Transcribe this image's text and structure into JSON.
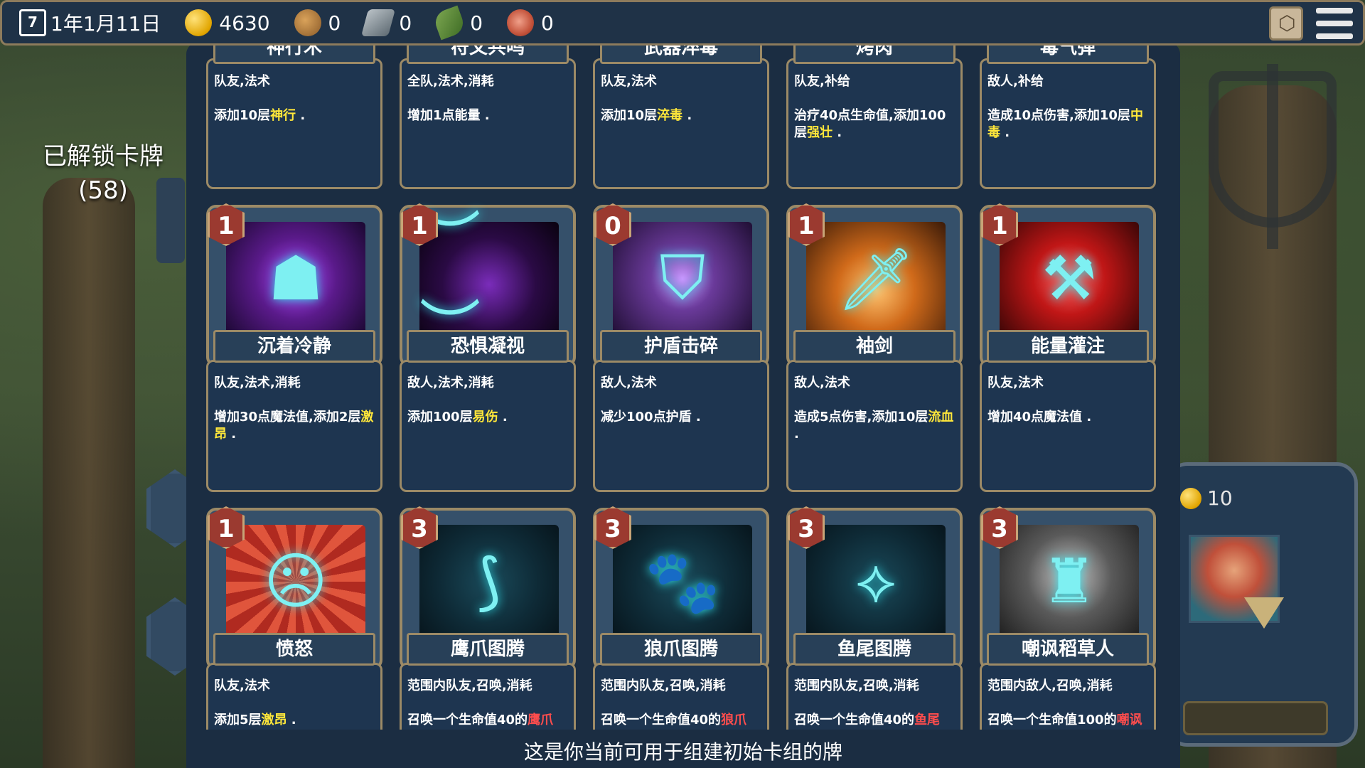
{
  "topbar": {
    "date": "1年1月11日",
    "calendar_day": "7",
    "gold": "4630",
    "wood": "0",
    "iron": "0",
    "herb": "0",
    "meat": "0"
  },
  "left": {
    "unlocked_title": "已解锁卡牌",
    "unlocked_count": "(58)"
  },
  "right": {
    "coin_value": "10"
  },
  "cards": [
    {
      "name": "神行术",
      "cost": "",
      "tags": "队友,法术",
      "desc": [
        {
          "t": "添加10层"
        },
        {
          "t": "神行",
          "c": "hl"
        },
        {
          "t": " ."
        }
      ],
      "art": "art-purple"
    },
    {
      "name": "符文共鸣",
      "cost": "",
      "tags": "全队,法术,消耗",
      "desc": [
        {
          "t": "增加1点能量 ."
        }
      ],
      "art": "art-purple"
    },
    {
      "name": "武器淬毒",
      "cost": "",
      "tags": "队友,法术",
      "desc": [
        {
          "t": "添加10层"
        },
        {
          "t": "淬毒",
          "c": "hl"
        },
        {
          "t": " ."
        }
      ],
      "art": "art-purple"
    },
    {
      "name": "烤肉",
      "cost": "",
      "tags": "队友,补给",
      "desc": [
        {
          "t": "治疗40点生命值,添加100层"
        },
        {
          "t": "强壮",
          "c": "hl"
        },
        {
          "t": " ."
        }
      ],
      "art": "art-purple"
    },
    {
      "name": "毒气弹",
      "cost": "",
      "tags": "敌人,补给",
      "desc": [
        {
          "t": "造成10点伤害,添加10层"
        },
        {
          "t": "中毒",
          "c": "hl"
        },
        {
          "t": " ."
        }
      ],
      "art": "art-purple"
    },
    {
      "name": "沉着冷静",
      "cost": "1",
      "tags": "队友,法术,消耗",
      "desc": [
        {
          "t": "增加30点魔法值,添加2层"
        },
        {
          "t": "激昂",
          "c": "hl"
        },
        {
          "t": " ."
        }
      ],
      "art": "art-purple",
      "glyph": "☗"
    },
    {
      "name": "恐惧凝视",
      "cost": "1",
      "tags": "敌人,法术,消耗",
      "desc": [
        {
          "t": "添加100层"
        },
        {
          "t": "易伤",
          "c": "hl"
        },
        {
          "t": " ."
        }
      ],
      "art": "art-dark",
      "glyph": "︶ ︶"
    },
    {
      "name": "护盾击碎",
      "cost": "0",
      "tags": "敌人,法术",
      "desc": [
        {
          "t": "减少100点护盾 ."
        }
      ],
      "art": "art-shield",
      "glyph": "⛉"
    },
    {
      "name": "袖剑",
      "cost": "1",
      "tags": "敌人,法术",
      "desc": [
        {
          "t": "造成5点伤害,添加10层"
        },
        {
          "t": "流血",
          "c": "hl"
        },
        {
          "t": " ."
        }
      ],
      "art": "art-fire",
      "glyph": "🗡"
    },
    {
      "name": "能量灌注",
      "cost": "1",
      "tags": "队友,法术",
      "desc": [
        {
          "t": "增加40点魔法值 ."
        }
      ],
      "art": "art-red",
      "glyph": "⚒"
    },
    {
      "name": "愤怒",
      "cost": "1",
      "tags": "队友,法术",
      "desc": [
        {
          "t": "添加5层"
        },
        {
          "t": "激昂",
          "c": "hl"
        },
        {
          "t": " ."
        }
      ],
      "art": "art-rage",
      "glyph": "☹"
    },
    {
      "name": "鹰爪图腾",
      "cost": "3",
      "tags": "范围内队友,召唤,消耗",
      "desc": [
        {
          "t": "召唤一个生命值40的"
        },
        {
          "t": "鹰爪",
          "c": "hl-red"
        }
      ],
      "art": "art-teal",
      "glyph": "⟆"
    },
    {
      "name": "狼爪图腾",
      "cost": "3",
      "tags": "范围内队友,召唤,消耗",
      "desc": [
        {
          "t": "召唤一个生命值40的"
        },
        {
          "t": "狼爪",
          "c": "hl-red"
        }
      ],
      "art": "art-teal",
      "glyph": "🐾"
    },
    {
      "name": "鱼尾图腾",
      "cost": "3",
      "tags": "范围内队友,召唤,消耗",
      "desc": [
        {
          "t": "召唤一个生命值40的"
        },
        {
          "t": "鱼尾",
          "c": "hl-red"
        }
      ],
      "art": "art-teal",
      "glyph": "⟡"
    },
    {
      "name": "嘲讽稻草人",
      "cost": "3",
      "tags": "范围内敌人,召唤,消耗",
      "desc": [
        {
          "t": "召唤一个生命值100的"
        },
        {
          "t": "嘲讽",
          "c": "hl-red"
        }
      ],
      "art": "art-grey",
      "glyph": "♜"
    }
  ],
  "footer": "这是你当前可用于组建初始卡组的牌"
}
